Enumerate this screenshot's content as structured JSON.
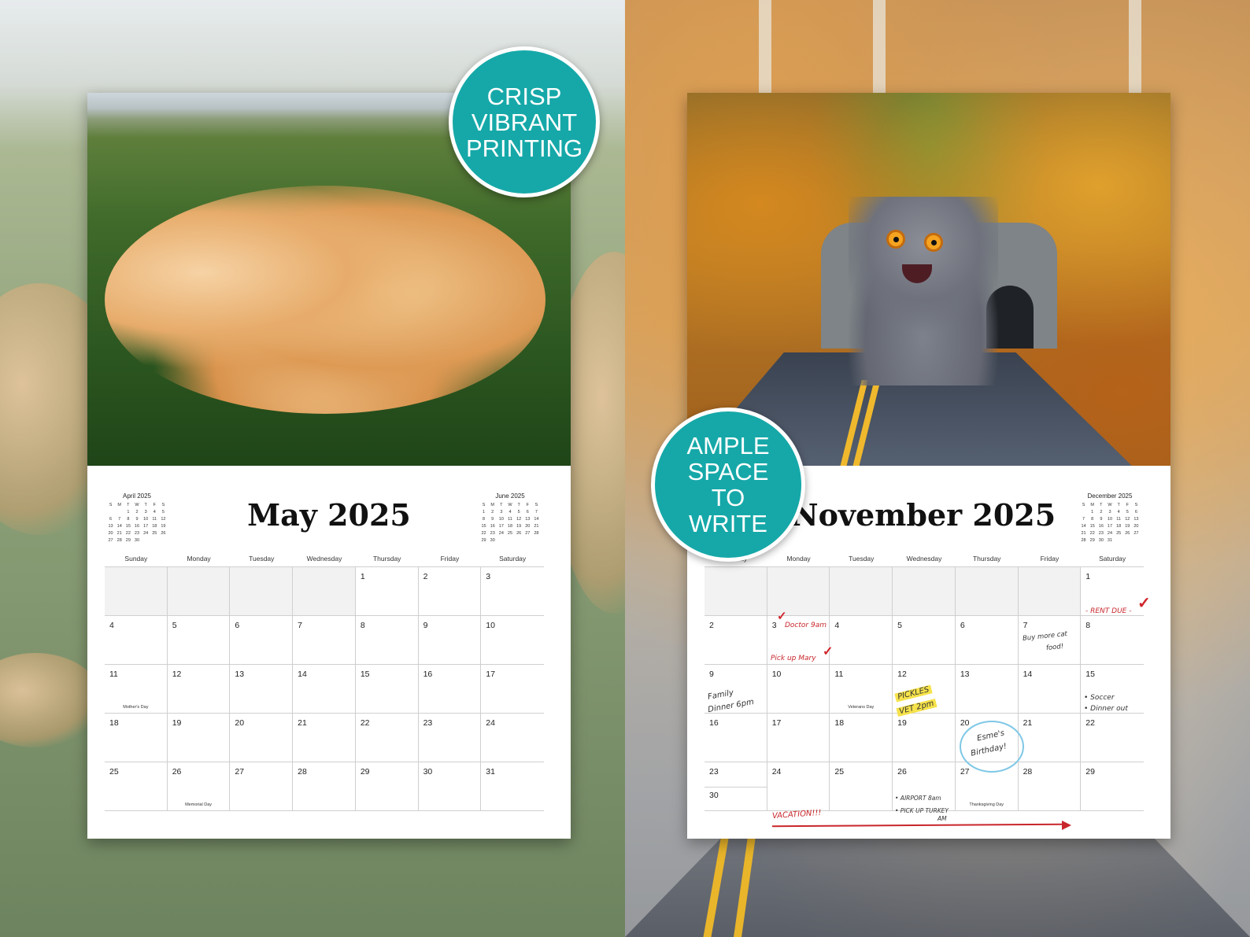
{
  "badges": {
    "left": [
      "CRISP",
      "VIBRANT",
      "PRINTING"
    ],
    "right": [
      "AMPLE",
      "SPACE",
      "TO",
      "WRITE"
    ]
  },
  "weekdays": [
    "Sunday",
    "Monday",
    "Tuesday",
    "Wednesday",
    "Thursday",
    "Friday",
    "Saturday"
  ],
  "mini_weekdays": [
    "S",
    "M",
    "T",
    "W",
    "T",
    "F",
    "S"
  ],
  "may": {
    "title": "May 2025",
    "prev_mini": {
      "title": "April 2025",
      "days": [
        "",
        "",
        "1",
        "2",
        "3",
        "4",
        "5",
        "6",
        "7",
        "8",
        "9",
        "10",
        "11",
        "12",
        "13",
        "14",
        "15",
        "16",
        "17",
        "18",
        "19",
        "20",
        "21",
        "22",
        "23",
        "24",
        "25",
        "26",
        "27",
        "28",
        "29",
        "30"
      ]
    },
    "next_mini": {
      "title": "June 2025",
      "days": [
        "1",
        "2",
        "3",
        "4",
        "5",
        "6",
        "7",
        "8",
        "9",
        "10",
        "11",
        "12",
        "13",
        "14",
        "15",
        "16",
        "17",
        "18",
        "19",
        "20",
        "21",
        "22",
        "23",
        "24",
        "25",
        "26",
        "27",
        "28",
        "29",
        "30"
      ]
    },
    "cells": [
      {
        "n": ""
      },
      {
        "n": ""
      },
      {
        "n": ""
      },
      {
        "n": ""
      },
      {
        "n": "1"
      },
      {
        "n": "2"
      },
      {
        "n": "3"
      },
      {
        "n": "4"
      },
      {
        "n": "5"
      },
      {
        "n": "6"
      },
      {
        "n": "7"
      },
      {
        "n": "8"
      },
      {
        "n": "9"
      },
      {
        "n": "10"
      },
      {
        "n": "11",
        "h": "Mother's Day"
      },
      {
        "n": "12"
      },
      {
        "n": "13"
      },
      {
        "n": "14"
      },
      {
        "n": "15"
      },
      {
        "n": "16"
      },
      {
        "n": "17"
      },
      {
        "n": "18"
      },
      {
        "n": "19"
      },
      {
        "n": "20"
      },
      {
        "n": "21"
      },
      {
        "n": "22"
      },
      {
        "n": "23"
      },
      {
        "n": "24"
      },
      {
        "n": "25"
      },
      {
        "n": "26",
        "h": "Memorial Day"
      },
      {
        "n": "27"
      },
      {
        "n": "28"
      },
      {
        "n": "29"
      },
      {
        "n": "30"
      },
      {
        "n": "31"
      }
    ]
  },
  "november": {
    "title": "November 2025",
    "next_mini": {
      "title": "December 2025",
      "days": [
        "",
        "1",
        "2",
        "3",
        "4",
        "5",
        "6",
        "7",
        "8",
        "9",
        "10",
        "11",
        "12",
        "13",
        "14",
        "15",
        "16",
        "17",
        "18",
        "19",
        "20",
        "21",
        "22",
        "23",
        "24",
        "25",
        "26",
        "27",
        "28",
        "29",
        "30",
        "31"
      ]
    },
    "cells": [
      {
        "n": ""
      },
      {
        "n": ""
      },
      {
        "n": ""
      },
      {
        "n": ""
      },
      {
        "n": ""
      },
      {
        "n": ""
      },
      {
        "n": "1"
      },
      {
        "n": "2"
      },
      {
        "n": "3"
      },
      {
        "n": "4"
      },
      {
        "n": "5"
      },
      {
        "n": "6"
      },
      {
        "n": "7"
      },
      {
        "n": "8"
      },
      {
        "n": "9"
      },
      {
        "n": "10"
      },
      {
        "n": "11",
        "h": "Veterans Day"
      },
      {
        "n": "12"
      },
      {
        "n": "13"
      },
      {
        "n": "14"
      },
      {
        "n": "15"
      },
      {
        "n": "16"
      },
      {
        "n": "17"
      },
      {
        "n": "18"
      },
      {
        "n": "19"
      },
      {
        "n": "20"
      },
      {
        "n": "21"
      },
      {
        "n": "22"
      },
      {
        "n": "23",
        "n2": "30"
      },
      {
        "n": "24"
      },
      {
        "n": "25"
      },
      {
        "n": "26"
      },
      {
        "n": "27",
        "h": "Thanksgiving Day"
      },
      {
        "n": "28"
      },
      {
        "n": "29"
      }
    ],
    "notes": {
      "rent": "- RENT DUE -",
      "doctor": "Doctor 9am",
      "pickup_mary": "Pick up Mary",
      "cat_food_1": "Buy more cat",
      "cat_food_2": "food!",
      "family_1": "Family",
      "family_2": "Dinner 6pm",
      "pickles_1": "PICKLES",
      "pickles_2": "VET 2pm",
      "soccer": "• Soccer",
      "dinner_out": "• Dinner out",
      "esme_1": "Esme's",
      "esme_2": "Birthday!",
      "airport": "• AIRPORT 8am",
      "turkey_1": "• PICK UP TURKEY",
      "turkey_2": "AM",
      "vacation": "VACATION!!!"
    }
  },
  "colors": {
    "badge": "#16a8a8",
    "ink_red": "#c8262b",
    "highlight": "#f6e24a",
    "circle": "#7fc8e6"
  },
  "icons": [
    "checkmark-icon",
    "arrow-right-icon"
  ]
}
